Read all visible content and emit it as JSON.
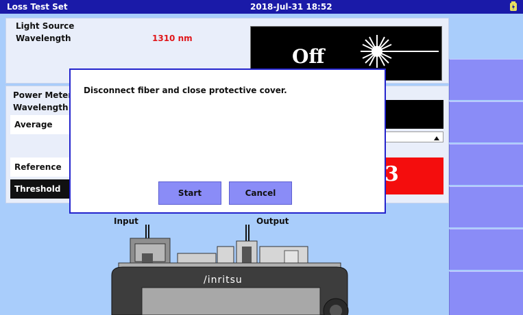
{
  "title_bar": {
    "app_title": "Loss Test Set",
    "datetime": "2018-Jul-31 18:52"
  },
  "light_source": {
    "heading": "Light Source",
    "wavelength_label": "Wavelength",
    "wavelength_value": "1310 nm",
    "output_state": "Off"
  },
  "power_meter": {
    "heading": "Power Meter",
    "wavelength_label": "Wavelength",
    "average_label": "Average",
    "reference_label": "Reference",
    "threshold_label": "Threshold",
    "partial_value": "3"
  },
  "diagram": {
    "input_label": "Input",
    "output_label": "Output",
    "device_brand": "/inritsu"
  },
  "dialog": {
    "message": "Disconnect fiber and close protective cover.",
    "start_label": "Start",
    "cancel_label": "Cancel"
  },
  "softkeys": {
    "count": 6
  },
  "colors": {
    "title_bar": "#1a1aa8",
    "background": "#a9cdfb",
    "softkey": "#8a8cf7",
    "alert_red": "#e0161a"
  }
}
